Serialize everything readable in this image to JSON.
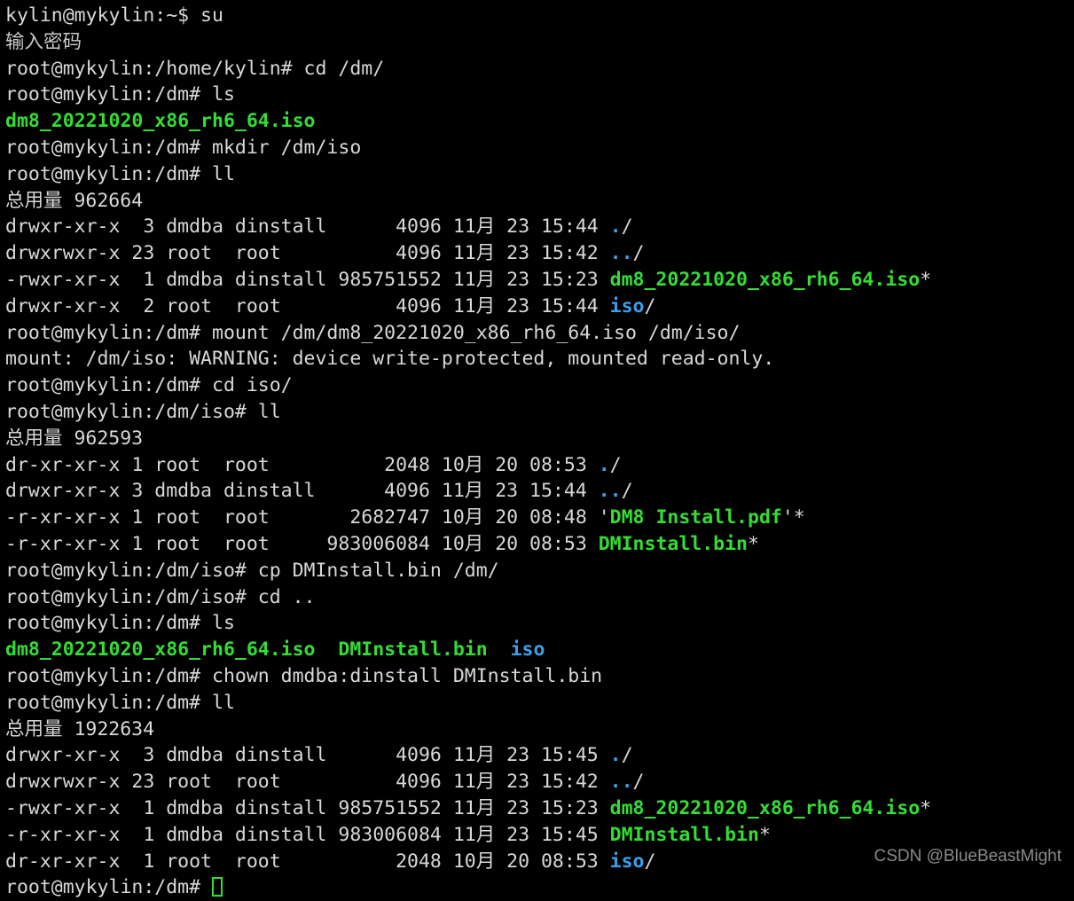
{
  "terminal": {
    "background": "#000000",
    "foreground": "#d8d8d8",
    "dir_color": "#3b9fe8",
    "exec_color": "#33dd33",
    "cursor_color": "#33dd33",
    "hostname": "mykylin",
    "watermark": "CSDN @BlueBeastMight",
    "lines": [
      {
        "id": "l01",
        "segs": [
          {
            "t": "kylin@mykylin:~$ su",
            "c": "white"
          }
        ]
      },
      {
        "id": "l02",
        "segs": [
          {
            "t": "输入密码",
            "c": "grey"
          }
        ]
      },
      {
        "id": "l03",
        "segs": [
          {
            "t": "root@mykylin:/home/kylin# cd /dm/",
            "c": "white"
          }
        ]
      },
      {
        "id": "l04",
        "segs": [
          {
            "t": "root@mykylin:/dm# ls",
            "c": "white"
          }
        ]
      },
      {
        "id": "l05",
        "segs": [
          {
            "t": "dm8_20221020_x86_rh6_64.iso",
            "c": "green"
          }
        ]
      },
      {
        "id": "l06",
        "segs": [
          {
            "t": "root@mykylin:/dm# mkdir /dm/iso",
            "c": "white"
          }
        ]
      },
      {
        "id": "l07",
        "segs": [
          {
            "t": "root@mykylin:/dm# ll",
            "c": "white"
          }
        ]
      },
      {
        "id": "l08",
        "segs": [
          {
            "t": "总用量 962664",
            "c": "white"
          }
        ]
      },
      {
        "id": "l09",
        "segs": [
          {
            "t": "drwxr-xr-x  3 dmdba dinstall      4096 11月 23 15:44 ",
            "c": "white"
          },
          {
            "t": ".",
            "c": "blue"
          },
          {
            "t": "/",
            "c": "white"
          }
        ]
      },
      {
        "id": "l10",
        "segs": [
          {
            "t": "drwxrwxr-x 23 root  root          4096 11月 23 15:42 ",
            "c": "white"
          },
          {
            "t": "..",
            "c": "blue"
          },
          {
            "t": "/",
            "c": "white"
          }
        ]
      },
      {
        "id": "l11",
        "segs": [
          {
            "t": "-rwxr-xr-x  1 dmdba dinstall 985751552 11月 23 15:23 ",
            "c": "white"
          },
          {
            "t": "dm8_20221020_x86_rh6_64.iso",
            "c": "green"
          },
          {
            "t": "*",
            "c": "white"
          }
        ]
      },
      {
        "id": "l12",
        "segs": [
          {
            "t": "drwxr-xr-x  2 root  root          4096 11月 23 15:44 ",
            "c": "white"
          },
          {
            "t": "iso",
            "c": "blue"
          },
          {
            "t": "/",
            "c": "white"
          }
        ]
      },
      {
        "id": "l13",
        "segs": [
          {
            "t": "root@mykylin:/dm# mount /dm/dm8_20221020_x86_rh6_64.iso /dm/iso/",
            "c": "white"
          }
        ]
      },
      {
        "id": "l14",
        "segs": [
          {
            "t": "mount: /dm/iso: WARNING: device write-protected, mounted read-only.",
            "c": "white"
          }
        ]
      },
      {
        "id": "l15",
        "segs": [
          {
            "t": "root@mykylin:/dm# cd iso/",
            "c": "white"
          }
        ]
      },
      {
        "id": "l16",
        "segs": [
          {
            "t": "root@mykylin:/dm/iso# ll",
            "c": "white"
          }
        ]
      },
      {
        "id": "l17",
        "segs": [
          {
            "t": "总用量 962593",
            "c": "white"
          }
        ]
      },
      {
        "id": "l18",
        "segs": [
          {
            "t": "dr-xr-xr-x 1 root  root          2048 10月 20 08:53 ",
            "c": "white"
          },
          {
            "t": ".",
            "c": "blue"
          },
          {
            "t": "/",
            "c": "white"
          }
        ]
      },
      {
        "id": "l19",
        "segs": [
          {
            "t": "drwxr-xr-x 3 dmdba dinstall      4096 11月 23 15:44 ",
            "c": "white"
          },
          {
            "t": "..",
            "c": "blue"
          },
          {
            "t": "/",
            "c": "white"
          }
        ]
      },
      {
        "id": "l20",
        "segs": [
          {
            "t": "-r-xr-xr-x 1 root  root       2682747 10月 20 08:48 ",
            "c": "white"
          },
          {
            "t": "'",
            "c": "white"
          },
          {
            "t": "DM8 Install.pdf",
            "c": "green"
          },
          {
            "t": "'*",
            "c": "white"
          }
        ]
      },
      {
        "id": "l21",
        "segs": [
          {
            "t": "-r-xr-xr-x 1 root  root     983006084 10月 20 08:53 ",
            "c": "white"
          },
          {
            "t": "DMInstall.bin",
            "c": "green"
          },
          {
            "t": "*",
            "c": "white"
          }
        ]
      },
      {
        "id": "l22",
        "segs": [
          {
            "t": "root@mykylin:/dm/iso# cp DMInstall.bin /dm/",
            "c": "white"
          }
        ]
      },
      {
        "id": "l23",
        "segs": [
          {
            "t": "root@mykylin:/dm/iso# cd ..",
            "c": "white"
          }
        ]
      },
      {
        "id": "l24",
        "segs": [
          {
            "t": "root@mykylin:/dm# ls",
            "c": "white"
          }
        ]
      },
      {
        "id": "l25",
        "segs": [
          {
            "t": "dm8_20221020_x86_rh6_64.iso",
            "c": "green"
          },
          {
            "t": "  ",
            "c": "white"
          },
          {
            "t": "DMInstall.bin",
            "c": "green"
          },
          {
            "t": "  ",
            "c": "white"
          },
          {
            "t": "iso",
            "c": "blue"
          }
        ]
      },
      {
        "id": "l26",
        "segs": [
          {
            "t": "root@mykylin:/dm# chown dmdba:dinstall DMInstall.bin",
            "c": "white"
          }
        ]
      },
      {
        "id": "l27",
        "segs": [
          {
            "t": "root@mykylin:/dm# ll",
            "c": "white"
          }
        ]
      },
      {
        "id": "l28",
        "segs": [
          {
            "t": "总用量 1922634",
            "c": "white"
          }
        ]
      },
      {
        "id": "l29",
        "segs": [
          {
            "t": "drwxr-xr-x  3 dmdba dinstall      4096 11月 23 15:45 ",
            "c": "white"
          },
          {
            "t": ".",
            "c": "blue"
          },
          {
            "t": "/",
            "c": "white"
          }
        ]
      },
      {
        "id": "l30",
        "segs": [
          {
            "t": "drwxrwxr-x 23 root  root          4096 11月 23 15:42 ",
            "c": "white"
          },
          {
            "t": "..",
            "c": "blue"
          },
          {
            "t": "/",
            "c": "white"
          }
        ]
      },
      {
        "id": "l31",
        "segs": [
          {
            "t": "-rwxr-xr-x  1 dmdba dinstall 985751552 11月 23 15:23 ",
            "c": "white"
          },
          {
            "t": "dm8_20221020_x86_rh6_64.iso",
            "c": "green"
          },
          {
            "t": "*",
            "c": "white"
          }
        ]
      },
      {
        "id": "l32",
        "segs": [
          {
            "t": "-r-xr-xr-x  1 dmdba dinstall 983006084 11月 23 15:45 ",
            "c": "white"
          },
          {
            "t": "DMInstall.bin",
            "c": "green"
          },
          {
            "t": "*",
            "c": "white"
          }
        ]
      },
      {
        "id": "l33",
        "segs": [
          {
            "t": "dr-xr-xr-x  1 root  root          2048 10月 20 08:53 ",
            "c": "white"
          },
          {
            "t": "iso",
            "c": "blue"
          },
          {
            "t": "/",
            "c": "white"
          }
        ]
      },
      {
        "id": "l34",
        "prompt": true,
        "segs": [
          {
            "t": "root@mykylin:/dm# ",
            "c": "white"
          }
        ]
      }
    ]
  }
}
